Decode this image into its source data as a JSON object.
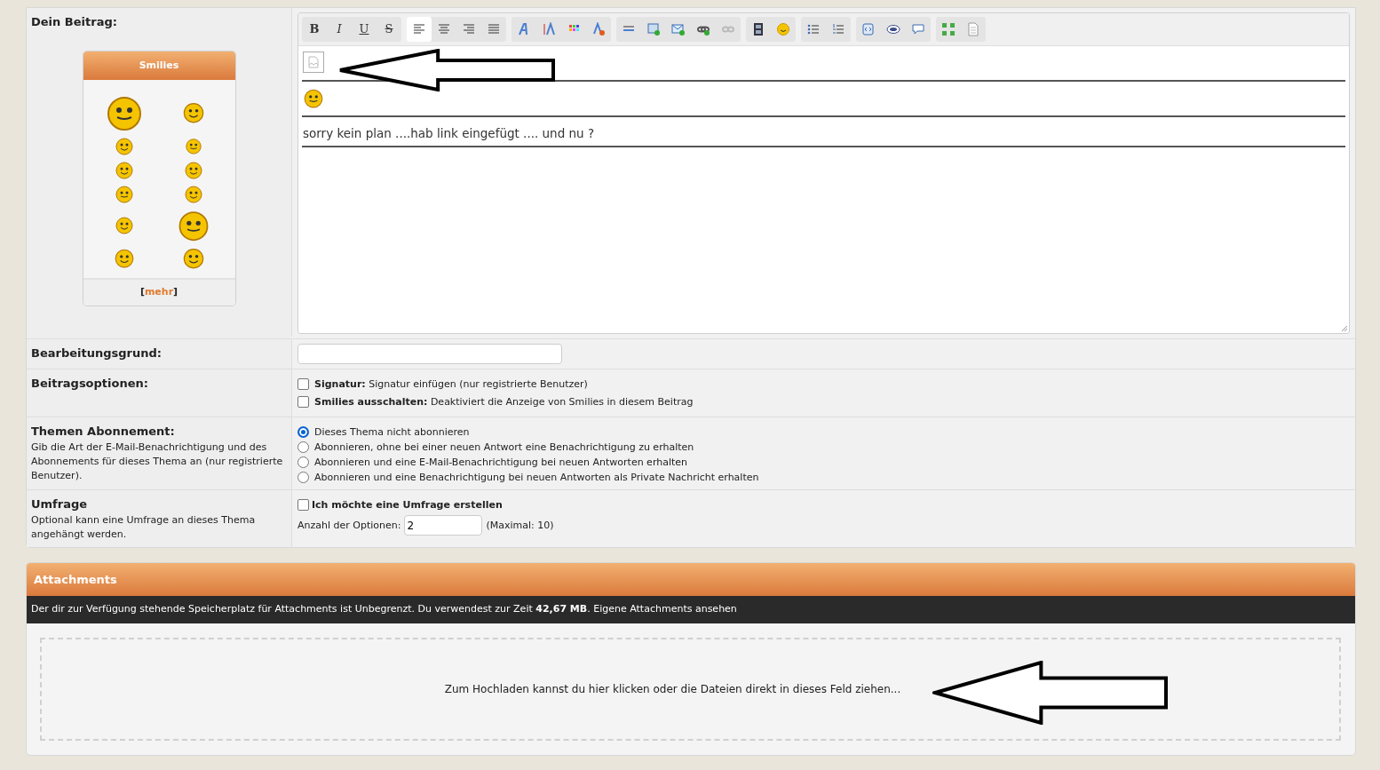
{
  "post": {
    "label": "Dein Beitrag:",
    "smilies": {
      "title": "Smilies",
      "more_prefix": "[",
      "more_link": "mehr",
      "more_suffix": "]"
    },
    "toolbar": [
      [
        {
          "kind": "bold",
          "label": "B"
        },
        {
          "kind": "italic",
          "label": "I"
        },
        {
          "kind": "underline",
          "label": "U"
        },
        {
          "kind": "strike",
          "label": "S"
        }
      ],
      [
        {
          "kind": "align-left",
          "selected": true
        },
        {
          "kind": "align-center",
          "selected": false
        },
        {
          "kind": "align-right",
          "selected": false
        },
        {
          "kind": "justify",
          "selected": false
        }
      ],
      [
        {
          "kind": "font"
        },
        {
          "kind": "font-size"
        },
        {
          "kind": "color"
        },
        {
          "kind": "remove-format"
        }
      ],
      [
        {
          "kind": "rule"
        },
        {
          "kind": "image"
        },
        {
          "kind": "email"
        },
        {
          "kind": "link"
        },
        {
          "kind": "unlink"
        }
      ],
      [
        {
          "kind": "video"
        },
        {
          "kind": "smiley"
        }
      ],
      [
        {
          "kind": "bullet-list"
        },
        {
          "kind": "number-list"
        }
      ],
      [
        {
          "kind": "code"
        },
        {
          "kind": "php"
        },
        {
          "kind": "quote"
        }
      ],
      [
        {
          "kind": "source"
        },
        {
          "kind": "page"
        }
      ]
    ],
    "content": [
      {
        "kind": "broken-image"
      },
      {
        "kind": "smiley"
      },
      {
        "kind": "text",
        "text": "sorry kein plan ....hab link eingefügt .... und nu ?"
      }
    ]
  },
  "reason": {
    "label": "Bearbeitungsgrund:"
  },
  "options": {
    "label": "Beitragsoptionen:",
    "checkboxes": [
      {
        "title": "Signatur:",
        "text": "Signatur einfügen (nur registrierte Benutzer)",
        "checked": false
      },
      {
        "title": "Smilies ausschalten:",
        "text": "Deaktiviert die Anzeige von Smilies in diesem Beitrag",
        "checked": false
      }
    ]
  },
  "subscription": {
    "label": "Themen Abonnement:",
    "description": "Gib die Art der E-Mail-Benachrichtigung und des Abonnements für dieses Thema an (nur registrierte Benutzer).",
    "radios": [
      {
        "label": "Dieses Thema nicht abonnieren",
        "selected": true
      },
      {
        "label": "Abonnieren, ohne bei einer neuen Antwort eine Benachrichtigung zu erhalten",
        "selected": false
      },
      {
        "label": "Abonnieren und eine E-Mail-Benachrichtigung bei neuen Antworten erhalten",
        "selected": false
      },
      {
        "label": "Abonnieren und eine Benachrichtigung bei neuen Antworten als Private Nachricht erhalten",
        "selected": false
      }
    ]
  },
  "poll": {
    "label": "Umfrage",
    "description": "Optional kann eine Umfrage an dieses Thema angehängt werden.",
    "checkbox": {
      "label": "Ich möchte eine Umfrage erstellen",
      "checked": false
    },
    "count_label": "Anzahl der Optionen:",
    "count_value": "2",
    "count_note": "(Maximal: 10)"
  },
  "attachments": {
    "title": "Attachments",
    "info": "Der dir zur Verfügung stehende Speicherplatz für Attachments ist Unbegrenzt. Du verwendest zur Zeit **42,67 MB**. Eigene Attachments ansehen",
    "dropzone": "Zum Hochladen kannst du hier klicken oder die Dateien direkt in dieses Feld ziehen..."
  }
}
